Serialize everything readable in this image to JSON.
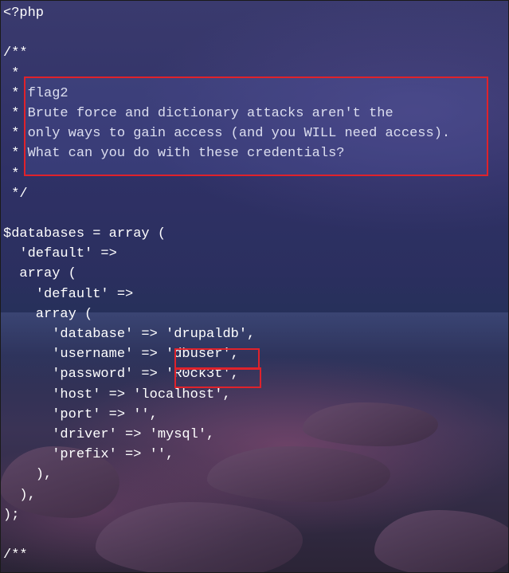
{
  "colors": {
    "text": "#ffffff",
    "highlight_border": "#e0222b"
  },
  "code_lines": [
    "<?php",
    "",
    "/**",
    " *",
    " * flag2",
    " * Brute force and dictionary attacks aren't the",
    " * only ways to gain access (and you WILL need access).",
    " * What can you do with these credentials?",
    " *",
    " */",
    "",
    "$databases = array (",
    "  'default' =>",
    "  array (",
    "    'default' =>",
    "    array (",
    "      'database' => 'drupaldb',",
    "      'username' => 'dbuser',",
    "      'password' => 'R0ck3t',",
    "      'host' => 'localhost',",
    "      'port' => '',",
    "      'driver' => 'mysql',",
    "      'prefix' => '',",
    "    ),",
    "  ),",
    ");",
    "",
    "/**"
  ]
}
